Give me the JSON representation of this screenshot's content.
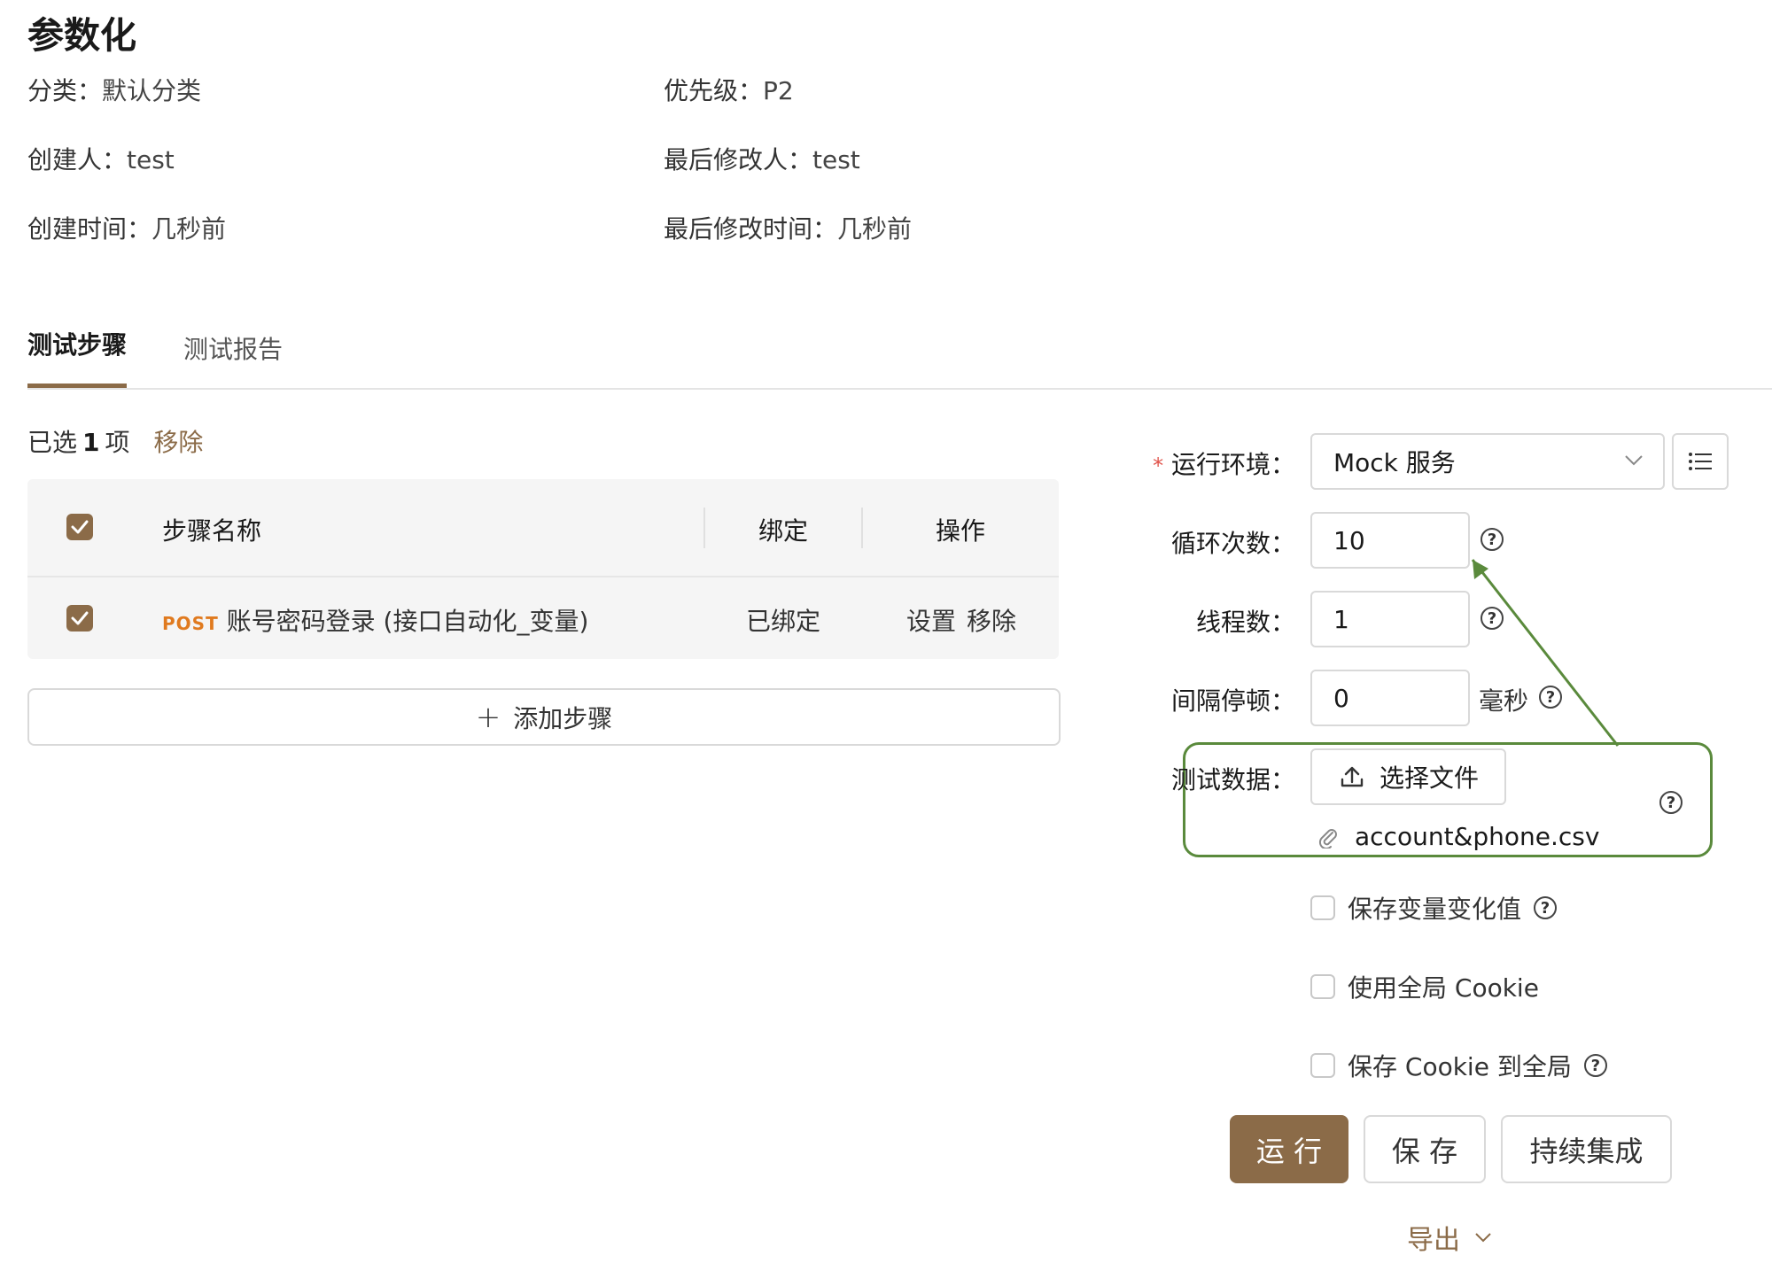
{
  "page": {
    "title": "参数化"
  },
  "meta": {
    "category_label": "分类：",
    "category_value": "默认分类",
    "priority_label": "优先级：",
    "priority_value": "P2",
    "creator_label": "创建人：",
    "creator_value": "test",
    "modifier_label": "最后修改人：",
    "modifier_value": "test",
    "created_label": "创建时间：",
    "created_value": "几秒前",
    "modified_label": "最后修改时间：",
    "modified_value": "几秒前"
  },
  "tabs": [
    {
      "label": "测试步骤",
      "active": true
    },
    {
      "label": "测试报告",
      "active": false
    }
  ],
  "selection": {
    "prefix": "已选",
    "count": "1",
    "suffix": "项",
    "remove_label": "移除"
  },
  "table": {
    "headers": {
      "name": "步骤名称",
      "binding": "绑定",
      "action": "操作"
    },
    "rows": [
      {
        "method": "POST",
        "name": "账号密码登录 (接口自动化_变量)",
        "binding": "已绑定",
        "action_set": "设置",
        "action_remove": "移除"
      }
    ],
    "add_label": "添加步骤"
  },
  "form": {
    "env_label": "运行环境：",
    "env_value": "Mock 服务",
    "loop_label": "循环次数：",
    "loop_value": "10",
    "threads_label": "线程数：",
    "threads_value": "1",
    "interval_label": "间隔停顿：",
    "interval_value": "0",
    "interval_unit": "毫秒",
    "testdata_label": "测试数据：",
    "upload_label": "选择文件",
    "file_name": "account&phone.csv",
    "options": [
      {
        "label": "保存变量变化值",
        "checked": false,
        "help": true
      },
      {
        "label": "使用全局 Cookie",
        "checked": false,
        "help": false
      },
      {
        "label": "保存 Cookie 到全局",
        "checked": false,
        "help": true
      }
    ]
  },
  "actions": {
    "run_label": "运 行",
    "save_label": "保 存",
    "ci_label": "持续集成",
    "export_label": "导出"
  },
  "colors": {
    "accent": "#8b6b48",
    "post": "#e07a1f",
    "annotation": "#5a8a3c",
    "required": "#e0524a"
  }
}
